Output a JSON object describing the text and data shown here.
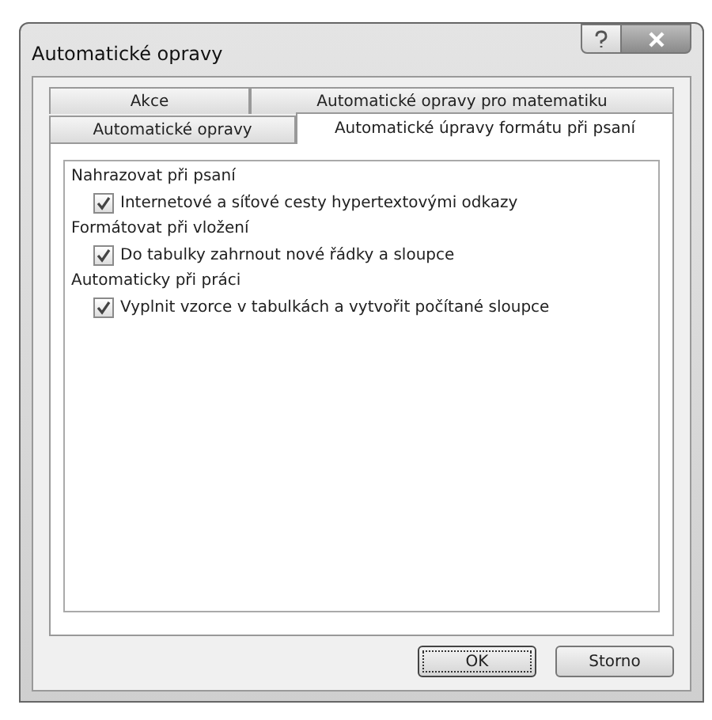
{
  "window": {
    "title": "Automatické opravy"
  },
  "tab_rows": [
    [
      {
        "label": "Akce",
        "selected": false
      },
      {
        "label": "Automatické opravy pro matematiku",
        "selected": false
      }
    ],
    [
      {
        "label": "Automatické opravy",
        "selected": false
      },
      {
        "label": "Automatické úpravy formátu při psaní",
        "selected": true
      }
    ]
  ],
  "groups": [
    {
      "heading": "Nahrazovat při psaní",
      "options": [
        {
          "label": "Internetové a síťové cesty hypertextovými odkazy",
          "checked": true
        }
      ]
    },
    {
      "heading": "Formátovat při vložení",
      "options": [
        {
          "label": "Do tabulky zahrnout nové řádky a sloupce",
          "checked": true
        }
      ]
    },
    {
      "heading": "Automaticky při práci",
      "options": [
        {
          "label": "Vyplnit vzorce v tabulkách a vytvořit počítané sloupce",
          "checked": true
        }
      ]
    }
  ],
  "buttons": [
    {
      "label": "OK",
      "default": true
    },
    {
      "label": "Storno",
      "default": false
    }
  ]
}
